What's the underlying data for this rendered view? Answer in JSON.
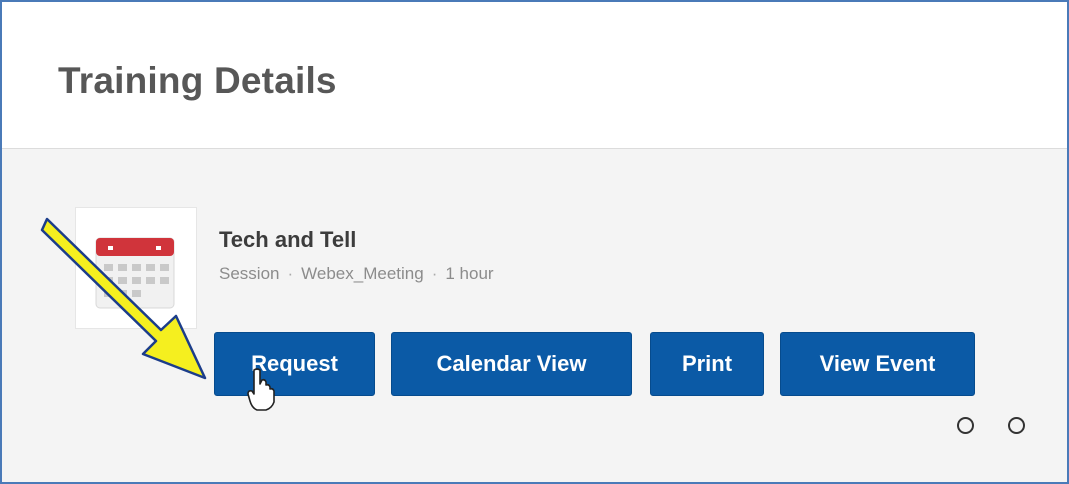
{
  "page": {
    "title": "Training Details"
  },
  "course": {
    "title": "Tech and Tell",
    "meta": [
      "Session",
      "Webex_Meeting",
      "1 hour"
    ],
    "icon": "calendar-icon"
  },
  "actions": {
    "request": "Request",
    "calendar_view": "Calendar View",
    "print": "Print",
    "view_event": "View Event"
  },
  "annotation": {
    "arrow_color": "#f5ef1f",
    "icon": "arrow-icon"
  },
  "colors": {
    "button": "#0b5aa6",
    "frame": "#4a7ab8"
  }
}
